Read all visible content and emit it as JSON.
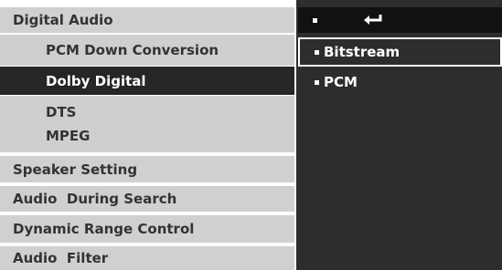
{
  "menu": {
    "digital_audio": "Digital Audio",
    "pcm_down_conversion": "PCM Down Conversion",
    "dolby_digital": "Dolby Digital",
    "dts": "DTS",
    "mpeg": "MPEG",
    "speaker_setting": "Speaker Setting",
    "audio_during_search": "Audio  During Search",
    "dynamic_range_control": "Dynamic Range Control",
    "audio_filter": "Audio  Filter"
  },
  "options": {
    "header_icon": "return-icon",
    "items": [
      "Bitstream",
      "PCM"
    ],
    "selected": "Bitstream"
  },
  "colors": {
    "menu_bg": "#d0d0d0",
    "selected_bg": "#262626",
    "panel_bg": "#2d2d2d",
    "text_dark": "#333333",
    "text_light": "#ffffff"
  }
}
